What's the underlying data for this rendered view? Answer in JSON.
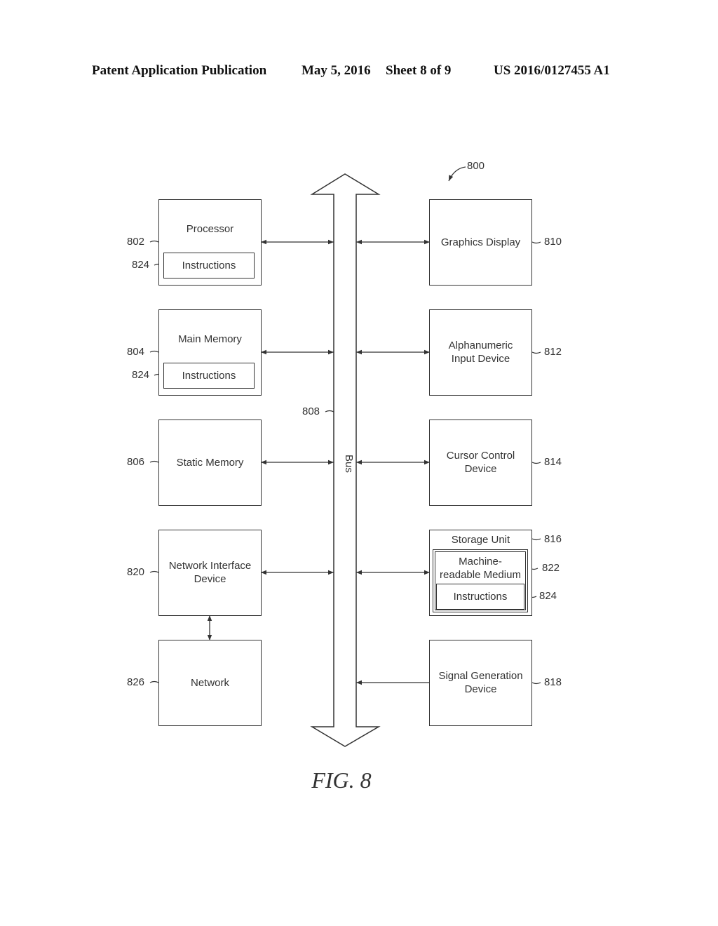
{
  "header": {
    "publication": "Patent Application Publication",
    "date": "May 5, 2016",
    "sheet": "Sheet 8 of 9",
    "number": "US 2016/0127455 A1"
  },
  "figure": {
    "ref": "800",
    "caption": "FIG. 8",
    "bus": {
      "label": "Bus",
      "ref": "808"
    }
  },
  "left_blocks": [
    {
      "label": "Processor",
      "ref": "802",
      "inner": {
        "label": "Instructions",
        "ref": "824"
      }
    },
    {
      "label": "Main Memory",
      "ref": "804",
      "inner": {
        "label": "Instructions",
        "ref": "824"
      }
    },
    {
      "label": "Static Memory",
      "ref": "806"
    },
    {
      "label": "Network Interface Device",
      "label_lines": [
        "Network Interface",
        "Device"
      ],
      "ref": "820"
    },
    {
      "label": "Network",
      "ref": "826"
    }
  ],
  "right_blocks": [
    {
      "label": "Graphics Display",
      "ref": "810"
    },
    {
      "label_lines": [
        "Alphanumeric",
        "Input Device"
      ],
      "ref": "812"
    },
    {
      "label_lines": [
        "Cursor Control",
        "Device"
      ],
      "ref": "814"
    },
    {
      "label": "Storage Unit",
      "ref": "816",
      "medium": {
        "label_lines": [
          "Machine-",
          "readable Medium"
        ],
        "ref": "822"
      },
      "instructions": {
        "label": "Instructions",
        "ref": "824"
      }
    },
    {
      "label_lines": [
        "Signal Generation",
        "Device"
      ],
      "ref": "818"
    }
  ]
}
